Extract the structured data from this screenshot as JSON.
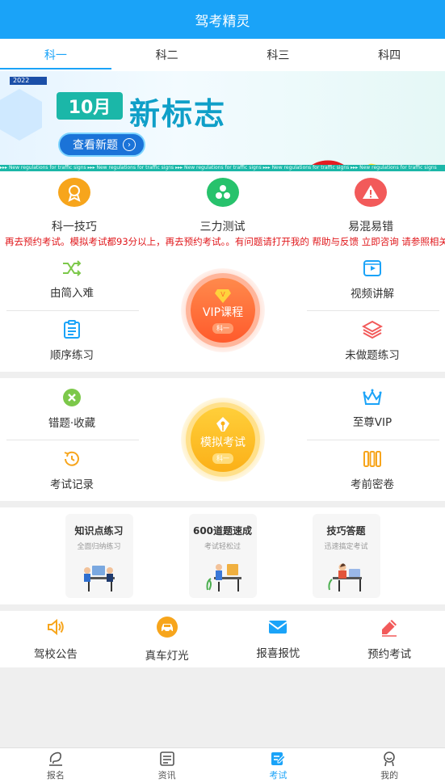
{
  "header": {
    "title": "驾考精灵"
  },
  "tabs": [
    {
      "label": "科一",
      "active": true
    },
    {
      "label": "科二",
      "active": false
    },
    {
      "label": "科三",
      "active": false
    },
    {
      "label": "科四",
      "active": false
    }
  ],
  "banner": {
    "year": "2022",
    "month": "10月",
    "headline": "新标志",
    "cta": "查看新题",
    "ticker": "▸▸▸  New regulations for traffic signs   ▸▸▸  New regulations for traffic signs   ▸▸▸  New regulations for traffic signs   ▸▸▸  New regulations for traffic signs   ▸▸▸  New regulations for traffic signs"
  },
  "quick": [
    {
      "label": "科一技巧",
      "icon": "medal-icon",
      "color": "#f7a51c"
    },
    {
      "label": "三力测试",
      "icon": "dots-icon",
      "color": "#27c26c"
    },
    {
      "label": "易混易错",
      "icon": "warning-icon",
      "color": "#f25a5a"
    }
  ],
  "marquee": "再去预约考试。模拟考试都93分以上，再去预约考试。。有问题请打开我的 帮助与反馈 立即咨询 请参照相关问",
  "practice": {
    "tl": "由简入难",
    "bl": "顺序练习",
    "tr": "视频讲解",
    "br": "未做题练习",
    "orb_title": "VIP课程",
    "orb_tag": "科一"
  },
  "exam": {
    "tl": "错题·收藏",
    "bl": "考试记录",
    "tr": "至尊VIP",
    "br": "考前密卷",
    "orb_title": "模拟考试",
    "orb_tag": "科一"
  },
  "features": [
    {
      "title": "知识点练习",
      "sub": "全面归纳练习"
    },
    {
      "title": "600道题速成",
      "sub": "考试轻松过"
    },
    {
      "title": "技巧答题",
      "sub": "迅速搞定考试"
    }
  ],
  "services": [
    {
      "label": "驾校公告",
      "icon": "speaker-icon",
      "color": "#f7a51c"
    },
    {
      "label": "真车灯光",
      "icon": "car-icon",
      "color": "#f7a51c"
    },
    {
      "label": "报喜报忧",
      "icon": "mail-icon",
      "color": "#1aa3f8"
    },
    {
      "label": "预约考试",
      "icon": "pen-icon",
      "color": "#f25a5a"
    }
  ],
  "nav": [
    {
      "label": "报名",
      "active": false
    },
    {
      "label": "资讯",
      "active": false
    },
    {
      "label": "考试",
      "active": true
    },
    {
      "label": "我的",
      "active": false
    }
  ]
}
